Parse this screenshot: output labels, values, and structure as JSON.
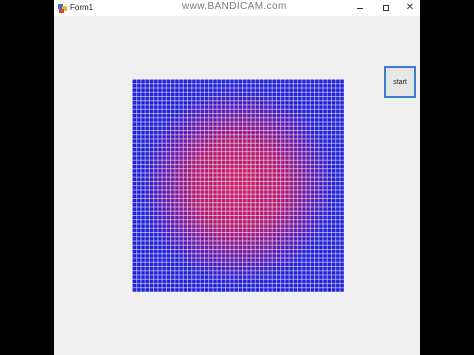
{
  "window": {
    "title": "Form1",
    "minimize_icon": "minimize-icon",
    "maximize_icon": "maximize-icon",
    "close_icon": "close-icon"
  },
  "watermark": {
    "text": "www.BANDICAM.com"
  },
  "main": {
    "start_label": "start",
    "grid": {
      "edge_color": "#2222d8",
      "center_color": "#d21e5f",
      "line_color": "#ffffff"
    }
  }
}
